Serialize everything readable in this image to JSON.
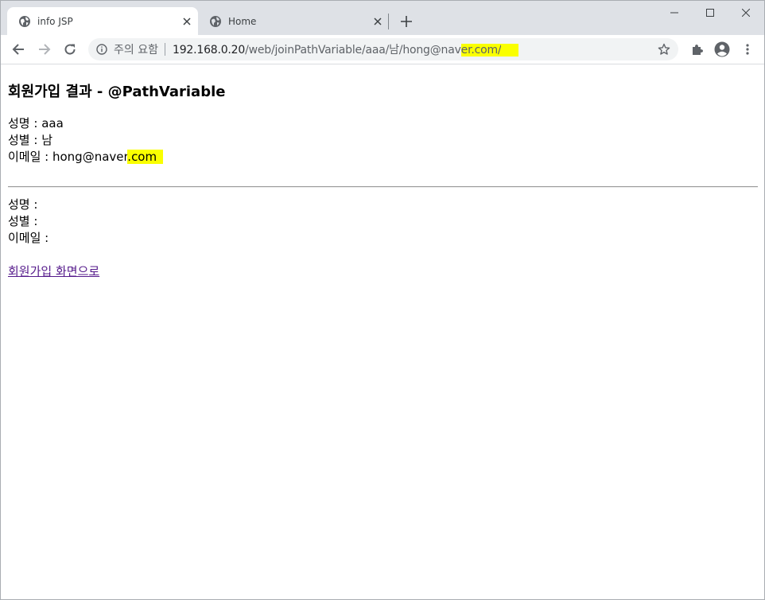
{
  "browser": {
    "tabs": [
      {
        "title": "info JSP",
        "icon": "globe-icon",
        "active": true
      },
      {
        "title": "Home",
        "icon": "globe-icon",
        "active": false
      }
    ],
    "omnibox": {
      "security_label": "주의 요함",
      "url_host": "192.168.0.20",
      "url_path_a": "/web/joinPathVariable/aaa/남/hong@nav",
      "url_path_highlight": "er.com/",
      "highlight_color": "#faff00"
    }
  },
  "page": {
    "title": "회원가입 결과 - @PathVariable",
    "result": {
      "name_line": "성명 : aaa",
      "gender_line": "성별 : 남",
      "email_prefix": "이메일 : hong@naver",
      "email_highlight": ".com"
    },
    "empty": {
      "name_line": "성명 :",
      "gender_line": "성별 :",
      "email_line": "이메일 :"
    },
    "back_link": "회원가입 화면으로",
    "link_color": "#551a8b"
  }
}
